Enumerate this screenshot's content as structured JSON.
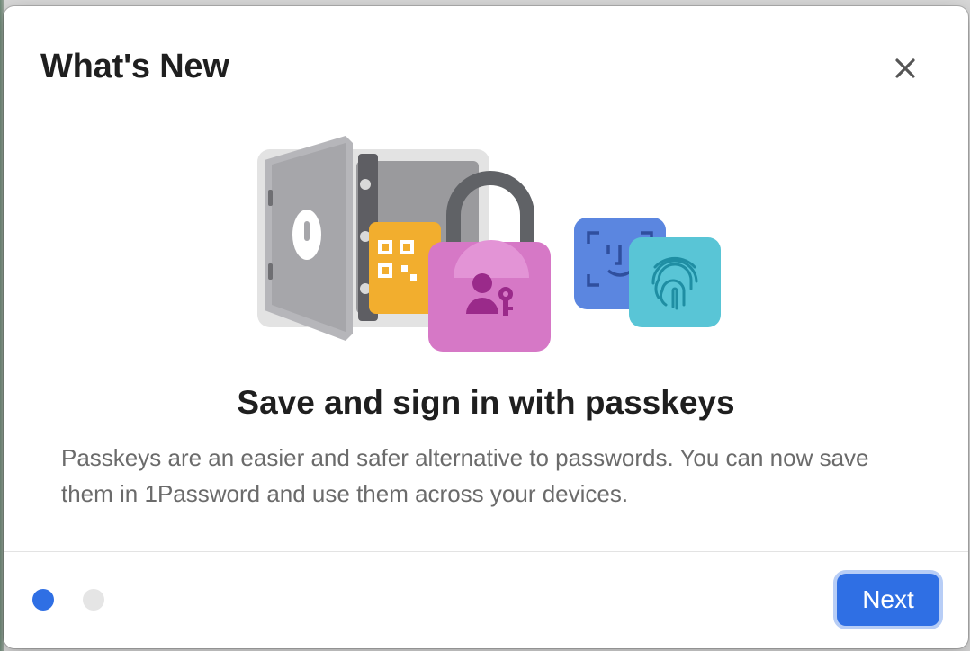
{
  "dialog": {
    "title": "What's New",
    "close_icon": "close-icon"
  },
  "slide": {
    "headline": "Save and sign in with passkeys",
    "body": "Passkeys are an easier and safer alternative to passwords. You can now save them in 1Password and use them across your devices.",
    "illustration_icons": [
      "vault-icon",
      "qr-code-icon",
      "padlock-icon",
      "user-key-icon",
      "face-id-icon",
      "fingerprint-icon"
    ]
  },
  "pagination": {
    "current": 1,
    "total": 2
  },
  "footer": {
    "next_label": "Next"
  },
  "colors": {
    "accent": "#2f6fe4",
    "padlock": "#d678c6",
    "qr_tile": "#f2ae2e",
    "face_id_tile": "#5b86e0",
    "fingerprint_tile": "#59c5d6"
  }
}
